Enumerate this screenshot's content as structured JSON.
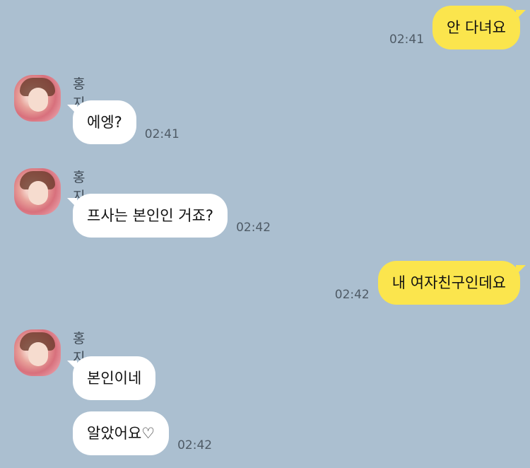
{
  "messages": [
    {
      "side": "right",
      "text": "안 다녀요",
      "time": "02:41"
    },
    {
      "side": "left",
      "sender": "홍지수",
      "texts": [
        "에엥?"
      ],
      "time": "02:41"
    },
    {
      "side": "left",
      "sender": "홍지수",
      "texts": [
        "프사는 본인인 거죠?"
      ],
      "time": "02:42"
    },
    {
      "side": "right",
      "text": "내 여자친구인데요",
      "time": "02:42"
    },
    {
      "side": "left",
      "sender": "홍지수",
      "texts": [
        "본인이네",
        "알았어요♡"
      ],
      "time": "02:42"
    }
  ],
  "colors": {
    "background": "#abbfd0",
    "my_bubble": "#fbe54d",
    "their_bubble": "#ffffff"
  }
}
